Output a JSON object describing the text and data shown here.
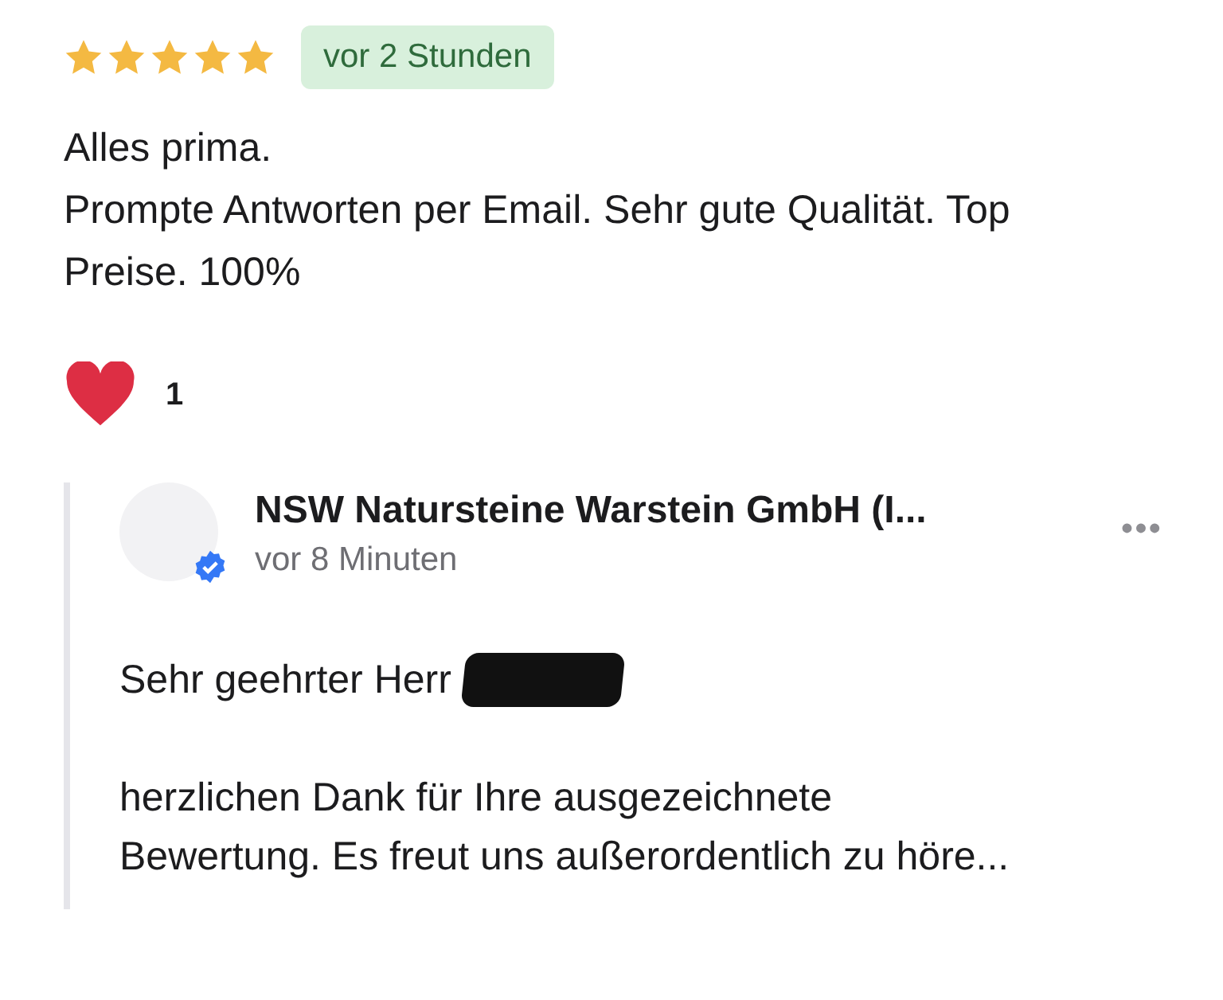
{
  "review": {
    "stars": 5,
    "time": "vor 2 Stunden",
    "text_lines": [
      "Alles prima.",
      "Prompte Antworten per Email. Sehr gute Qualität. Top Preise. 100%"
    ],
    "reactions": {
      "count": "1"
    }
  },
  "reply": {
    "author": "NSW Natursteine Warstein GmbH (I...",
    "verified": true,
    "time": "vor 8 Minuten",
    "menu": "•••",
    "greeting": "Sehr geehrter Herr",
    "redacted": true,
    "body": "herzlichen Dank für Ihre ausgezeichnete Bewertung. Es freut uns außerordentlich zu höre..."
  }
}
